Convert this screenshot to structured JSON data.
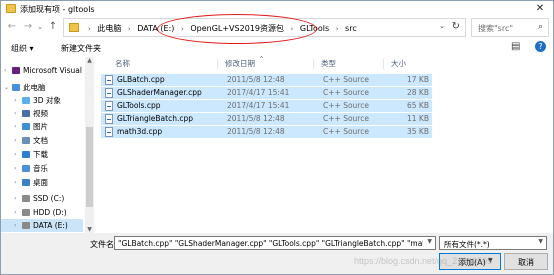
{
  "window": {
    "title": "添加现有项 - gltools",
    "close_glyph": "✕"
  },
  "address": {
    "crumbs": [
      "此电脑",
      "DATA (E:)",
      "OpenGL+VS2019资源包",
      "GLTools",
      "src"
    ]
  },
  "search": {
    "placeholder": "搜索\"src\""
  },
  "toolbar": {
    "organize": "组织 ▾",
    "new_folder": "新建文件夹"
  },
  "sidebar": {
    "items": [
      {
        "label": "Microsoft Visual",
        "icon": "visual-studio-icon",
        "chevron": "›",
        "selected": false
      },
      {
        "label": "此电脑",
        "icon": "computer-icon",
        "chevron": "⌄",
        "selected": false
      },
      {
        "label": "3D 对象",
        "icon": "3d-objects-icon",
        "chevron": "›",
        "selected": false
      },
      {
        "label": "视频",
        "icon": "video-icon",
        "chevron": "›",
        "selected": false
      },
      {
        "label": "图片",
        "icon": "pictures-icon",
        "chevron": "›",
        "selected": false
      },
      {
        "label": "文档",
        "icon": "documents-icon",
        "chevron": "›",
        "selected": false
      },
      {
        "label": "下载",
        "icon": "downloads-icon",
        "chevron": "›",
        "selected": false
      },
      {
        "label": "音乐",
        "icon": "music-icon",
        "chevron": "›",
        "selected": false
      },
      {
        "label": "桌面",
        "icon": "desktop-icon",
        "chevron": "›",
        "selected": false
      },
      {
        "label": "SSD (C:)",
        "icon": "drive-icon",
        "chevron": "›",
        "selected": false
      },
      {
        "label": "HDD (D:)",
        "icon": "drive-icon",
        "chevron": "›",
        "selected": false
      },
      {
        "label": "DATA (E:)",
        "icon": "drive-icon",
        "chevron": "›",
        "selected": true
      }
    ]
  },
  "columns": {
    "name": "名称",
    "date": "修改日期",
    "type": "类型",
    "size": "大小",
    "sort_glyph": "^"
  },
  "files": [
    {
      "name": "GLBatch.cpp",
      "date": "2011/5/8 12:48",
      "type": "C++ Source",
      "size": "17 KB"
    },
    {
      "name": "GLShaderManager.cpp",
      "date": "2017/4/17 15:41",
      "type": "C++ Source",
      "size": "28 KB"
    },
    {
      "name": "GLTools.cpp",
      "date": "2017/4/17 15:41",
      "type": "C++ Source",
      "size": "65 KB"
    },
    {
      "name": "GLTriangleBatch.cpp",
      "date": "2011/5/8 12:48",
      "type": "C++ Source",
      "size": "11 KB"
    },
    {
      "name": "math3d.cpp",
      "date": "2011/5/8 12:48",
      "type": "C++ Source",
      "size": "35 KB"
    }
  ],
  "footer": {
    "filename_label": "文件名(N):",
    "filename_value": "\"GLBatch.cpp\" \"GLShaderManager.cpp\" \"GLTools.cpp\" \"GLTriangleBatch.cpp\" \"math3d.cp",
    "filetype_value": "所有文件(*.*)",
    "add_button": "添加(A)",
    "cancel_button": "取消",
    "watermark": "https://blog.csdn.net/qq_21049505"
  },
  "colors": {
    "selection": "#cce8ff",
    "annotation_loop": "#e31b1b",
    "primary_border": "#0078d7"
  }
}
